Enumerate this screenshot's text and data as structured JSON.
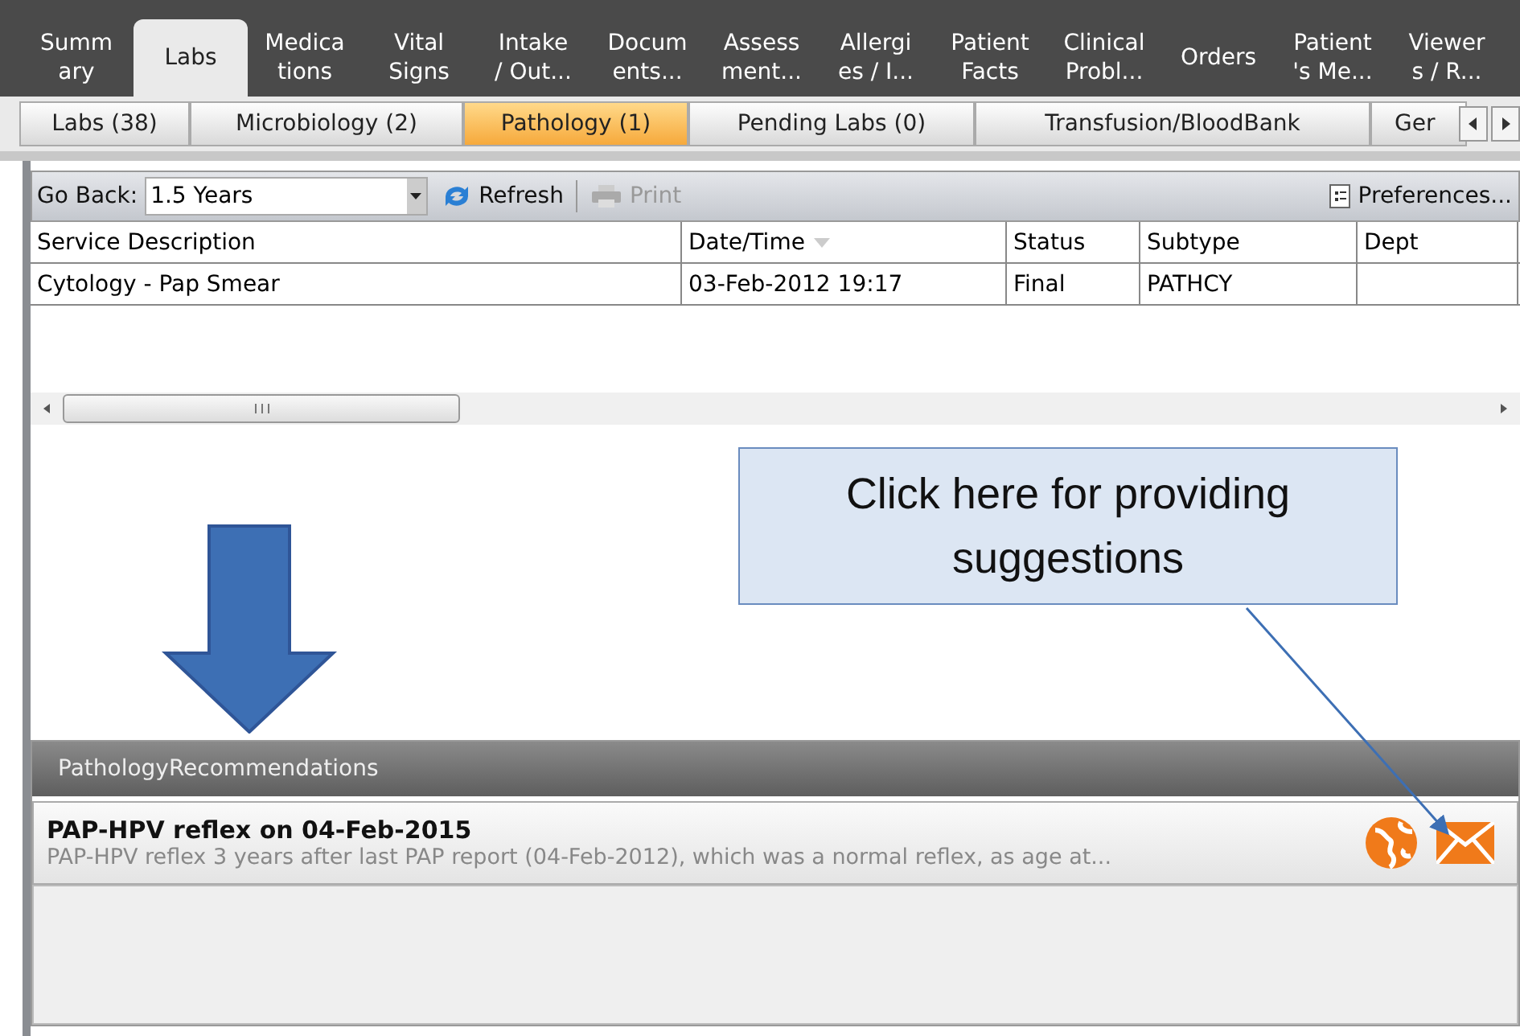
{
  "main_tabs": [
    {
      "label": "Summ\nary",
      "selected": false
    },
    {
      "label": "Labs",
      "selected": true
    },
    {
      "label": "Medica\ntions",
      "selected": false
    },
    {
      "label": "Vital\nSigns",
      "selected": false
    },
    {
      "label": "Intake\n/ Out...",
      "selected": false
    },
    {
      "label": "Docum\nents...",
      "selected": false
    },
    {
      "label": "Assess\nment...",
      "selected": false
    },
    {
      "label": "Allergi\nes / I...",
      "selected": false
    },
    {
      "label": "Patient\nFacts",
      "selected": false
    },
    {
      "label": "Clinical\nProbl...",
      "selected": false
    },
    {
      "label": "Orders",
      "selected": false
    },
    {
      "label": "Patient\n's Me...",
      "selected": false
    },
    {
      "label": "Viewer\ns / R...",
      "selected": false
    }
  ],
  "sub_tabs": [
    {
      "label": "Labs (38)",
      "selected": false
    },
    {
      "label": "Microbiology (2)",
      "selected": false
    },
    {
      "label": "Pathology (1)",
      "selected": true
    },
    {
      "label": "Pending Labs (0)",
      "selected": false
    },
    {
      "label": "Transfusion/BloodBank",
      "selected": false
    },
    {
      "label": "Ger",
      "selected": false
    }
  ],
  "toolbar": {
    "go_back_label": "Go Back:",
    "go_back_value": "1.5 Years",
    "refresh": "Refresh",
    "print": "Print",
    "print_disabled": true,
    "preferences": "Preferences..."
  },
  "table": {
    "columns": [
      {
        "label": "Service Description",
        "sorted": false
      },
      {
        "label": "Date/Time",
        "sorted": true
      },
      {
        "label": "Status",
        "sorted": false
      },
      {
        "label": "Subtype",
        "sorted": false
      },
      {
        "label": "Dept",
        "sorted": false
      }
    ],
    "rows": [
      [
        "Cytology - Pap Smear",
        "03-Feb-2012 19:17",
        "Final",
        "PATHCY"
      ]
    ]
  },
  "callout": {
    "text": "Click here for providing suggestions"
  },
  "recommendations": {
    "title": "PathologyRecommendations",
    "items": [
      {
        "title": "PAP-HPV reflex on 04-Feb-2015",
        "description": "PAP-HPV reflex 3 years after last PAP report (04-Feb-2012), which was a normal reflex, as age at..."
      }
    ]
  }
}
